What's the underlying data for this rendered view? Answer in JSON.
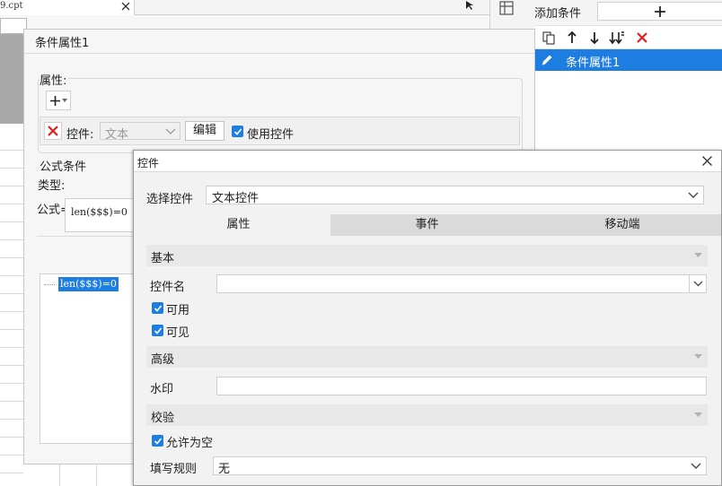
{
  "background": {
    "tab_title": "9.cpt",
    "colors": {
      "selection": "#1e7de0",
      "delete": "#e02020"
    }
  },
  "right_panel": {
    "add_condition_label": "添加条件",
    "add_button": "+",
    "toolbar_icons": [
      "copy-icon",
      "arrow-up-icon",
      "arrow-down-icon",
      "sort-down-icon",
      "delete-icon"
    ],
    "list": [
      {
        "label": "条件属性1",
        "selected": true
      }
    ]
  },
  "condition_dialog": {
    "title": "条件属性1",
    "property_label": "属性:",
    "add_button": "+",
    "control_label": "控件:",
    "control_value": "文本",
    "edit_button": "编辑",
    "use_control_label": "使用控件",
    "use_control_checked": true,
    "formula_condition_label": "公式条件",
    "type_label": "类型:",
    "formula_label": "公式=",
    "formula_value": "len($$$)=0",
    "tree_item": "len($$$)=0"
  },
  "control_dialog": {
    "title": "控件",
    "select_control_label": "选择控件",
    "select_control_value": "文本控件",
    "tabs": [
      {
        "label": "属性",
        "active": true
      },
      {
        "label": "事件",
        "active": false
      },
      {
        "label": "移动端",
        "active": false
      }
    ],
    "basic_section": "基本",
    "control_name_label": "控件名",
    "control_name_value": "",
    "enabled_label": "可用",
    "enabled_checked": true,
    "visible_label": "可见",
    "visible_checked": true,
    "advanced_section": "高级",
    "watermark_label": "水印",
    "watermark_value": "",
    "validation_section": "校验",
    "allow_empty_label": "允许为空",
    "allow_empty_checked": true,
    "fill_rule_label": "填写规则",
    "fill_rule_value": "无"
  }
}
